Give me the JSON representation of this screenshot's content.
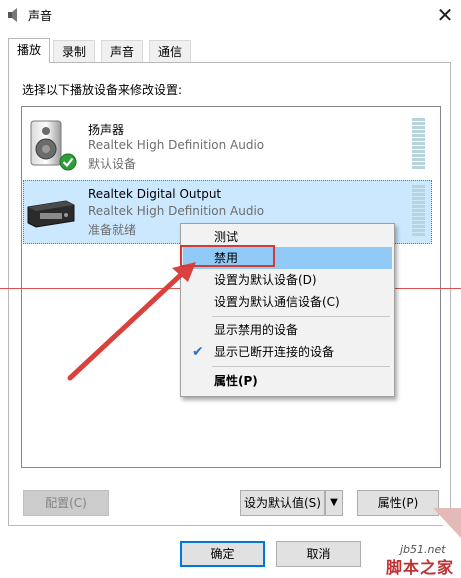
{
  "window": {
    "title": "声音"
  },
  "tabs": [
    {
      "label": "播放",
      "active": true
    },
    {
      "label": "录制",
      "active": false
    },
    {
      "label": "声音",
      "active": false
    },
    {
      "label": "通信",
      "active": false
    }
  ],
  "instruction": "选择以下播放设备来修改设置:",
  "devices": [
    {
      "name": "扬声器",
      "driver": "Realtek High Definition Audio",
      "status": "默认设备",
      "icon": "speaker-icon",
      "badge": "default-check-icon",
      "selected": false
    },
    {
      "name": "Realtek Digital Output",
      "driver": "Realtek High Definition Audio",
      "status": "准备就绪",
      "icon": "digital-output-icon",
      "selected": true
    }
  ],
  "context_menu": {
    "items": [
      {
        "label": "测试",
        "highlighted": false,
        "checked": false
      },
      {
        "label": "禁用",
        "highlighted": true,
        "checked": false
      },
      {
        "label": "设置为默认设备(D)",
        "highlighted": false,
        "checked": false
      },
      {
        "label": "设置为默认通信设备(C)",
        "highlighted": false,
        "checked": false
      },
      {
        "label": "显示禁用的设备",
        "highlighted": false,
        "checked": false
      },
      {
        "label": "显示已断开连接的设备",
        "highlighted": false,
        "checked": true
      },
      {
        "label": "属性(P)",
        "highlighted": false,
        "checked": false,
        "bold": true
      }
    ]
  },
  "buttons": {
    "configure": "配置(C)",
    "set_default": "设为默认值(S)",
    "set_default_dropdown": "▼",
    "properties": "属性(P)",
    "ok": "确定",
    "cancel": "取消"
  },
  "watermark": {
    "site": "jb51.net",
    "brand": "脚本之家"
  },
  "colors": {
    "selection": "#cce8ff",
    "menu_highlight": "#91c9f7",
    "annotation_red": "#d23a3a",
    "accent": "#0078d7"
  }
}
